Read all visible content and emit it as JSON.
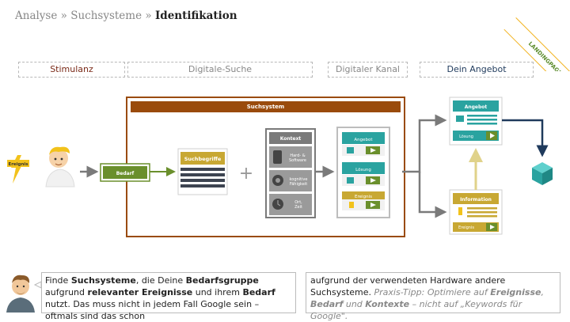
{
  "breadcrumb": {
    "part1": "Analyse",
    "sep1": " » ",
    "part2": "Suchsysteme",
    "sep2": " » ",
    "current": "Identifikation"
  },
  "stages": [
    {
      "label": "Stimulanz",
      "color": "#7a2a18"
    },
    {
      "label": "Digitale-Suche",
      "color": "#888888"
    },
    {
      "label": "Digitaler Kanal",
      "color": "#888888"
    },
    {
      "label": "Dein Angebot",
      "color": "#1f3a5c"
    }
  ],
  "diagram": {
    "event_label": "Ereignis",
    "need_label": "Bedarf",
    "system_title": "Suchsystem",
    "search_terms_title": "Suchbegriffe",
    "context_title": "Kontext",
    "context_items": [
      {
        "label": "Hard- & Software",
        "icon": "device-icon"
      },
      {
        "label": "kognitive Fähigkeit",
        "icon": "gear-head-icon"
      },
      {
        "label": "Ort, Zeit",
        "icon": "location-clock-icon"
      }
    ],
    "channel_items": [
      "Angebot",
      "Lösung",
      "Ereignis"
    ],
    "offer_title": "Angebot",
    "offer_row_label": "Lösung",
    "info_title": "Information",
    "info_row_label": "Ereignis",
    "plus_sign": "+",
    "colors": {
      "brown": "#9a4b0c",
      "green": "#6a8f2c",
      "teal": "#2aa3a0",
      "navy": "#1f3a5c",
      "olive": "#c8a833",
      "gray": "#7a7a7a"
    }
  },
  "badge": {
    "text": "LANDINGPAGES"
  },
  "note_left": {
    "t1": "Finde ",
    "b1": "Suchsysteme",
    "t2": ", die Deine ",
    "b2": "Bedarfsgruppe",
    "t3": " aufgrund ",
    "b3": "relevanter Ereignisse",
    "t4": " und ihrem ",
    "b4": "Bedarf",
    "t5": " nutzt. Das muss nicht in jedem Fall Google sein – oftmals sind das schon"
  },
  "note_right": {
    "t1": "aufgrund der verwendeten Hardware andere Suchsysteme. ",
    "tip1": "Praxis-Tipp: Optimiere auf ",
    "tb1": "Ereignisse",
    "tip2": ", ",
    "tb2": "Bedarf",
    "tip3": " und ",
    "tb3": "Kontexte",
    "tip4": " – nicht auf „Keywords für Google\"."
  }
}
